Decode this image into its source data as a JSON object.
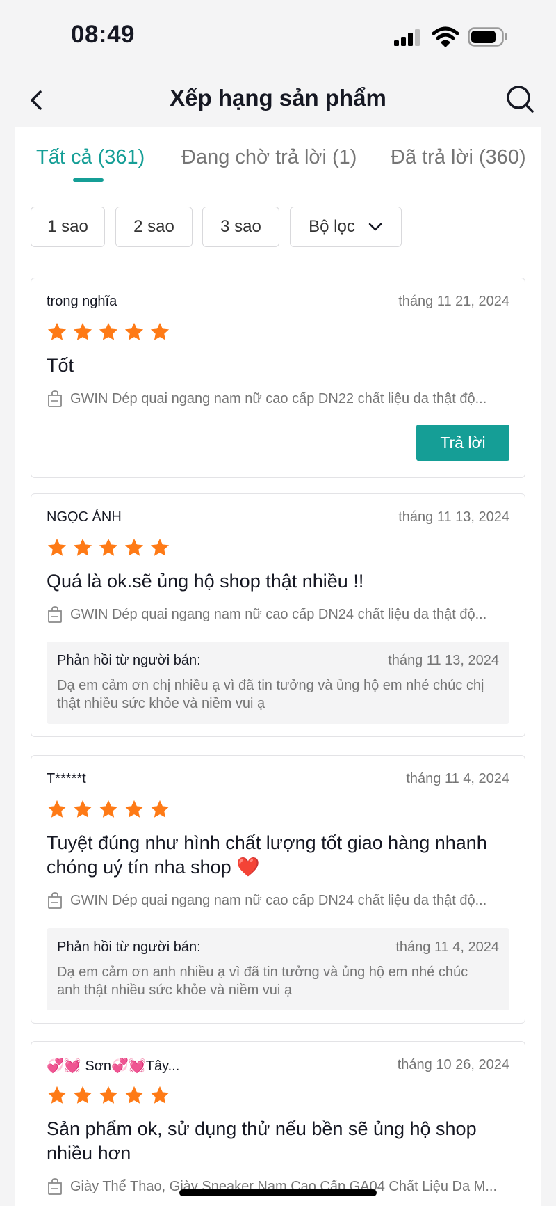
{
  "status_bar": {
    "time": "08:49"
  },
  "header": {
    "title": "Xếp hạng sản phẩm"
  },
  "tabs": [
    {
      "label": "Tất cả (361)",
      "active": true
    },
    {
      "label": "Đang chờ trả lời (1)",
      "active": false
    },
    {
      "label": "Đã trả lời (360)",
      "active": false
    }
  ],
  "filters": [
    {
      "label": "1 sao"
    },
    {
      "label": "2 sao"
    },
    {
      "label": "3 sao"
    },
    {
      "label": "Bộ lọc"
    }
  ],
  "colors": {
    "accent": "#159e96",
    "star": "#fe7a16",
    "background": "#f4f4f5"
  },
  "reviews": [
    {
      "reviewer": "trong nghĩa",
      "date": "tháng 11 21, 2024",
      "rating": 5,
      "text": "Tốt",
      "product": "GWIN Dép quai ngang nam nữ cao cấp DN22 chất liệu da thật độ...",
      "reply_button": "Trả lời"
    },
    {
      "reviewer": "NGỌC ÁNH",
      "date": "tháng 11 13, 2024",
      "rating": 5,
      "text": "Quá là ok.sẽ ủng hộ shop thật nhiều !!",
      "product": "GWIN Dép quai ngang nam nữ cao cấp DN24 chất liệu da thật độ...",
      "seller_reply": {
        "label": "Phản hồi từ người bán:",
        "date": "tháng 11 13, 2024",
        "text": "Dạ em cảm ơn chị nhiều ạ vì đã tin tưởng và ủng hộ em nhé chúc chị thật nhiều sức khỏe và niềm vui ạ"
      }
    },
    {
      "reviewer": "T*****t",
      "date": "tháng 11 4, 2024",
      "rating": 5,
      "text": "Tuyệt đúng như hình chất lượng tốt giao hàng nhanh chóng uý tín nha shop ❤️",
      "product": "GWIN Dép quai ngang nam nữ cao cấp DN24 chất liệu da thật độ...",
      "seller_reply": {
        "label": "Phản hồi từ người bán:",
        "date": "tháng 11 4, 2024",
        "text": "Dạ em cảm ơn anh nhiều ạ vì đã tin tưởng và ủng hộ em nhé chúc anh thật nhiều sức khỏe và niềm vui ạ"
      }
    },
    {
      "reviewer": "💞💓 Sơn💞💓Tây...",
      "date": "tháng 10 26, 2024",
      "rating": 5,
      "text": "Sản phẩm ok, sử dụng thử nếu bền sẽ ủng hộ shop nhiều hơn",
      "product": "Giày Thể Thao, Giày Sneaker Nam Cao Cấp GA04 Chất Liệu Da M..."
    }
  ]
}
